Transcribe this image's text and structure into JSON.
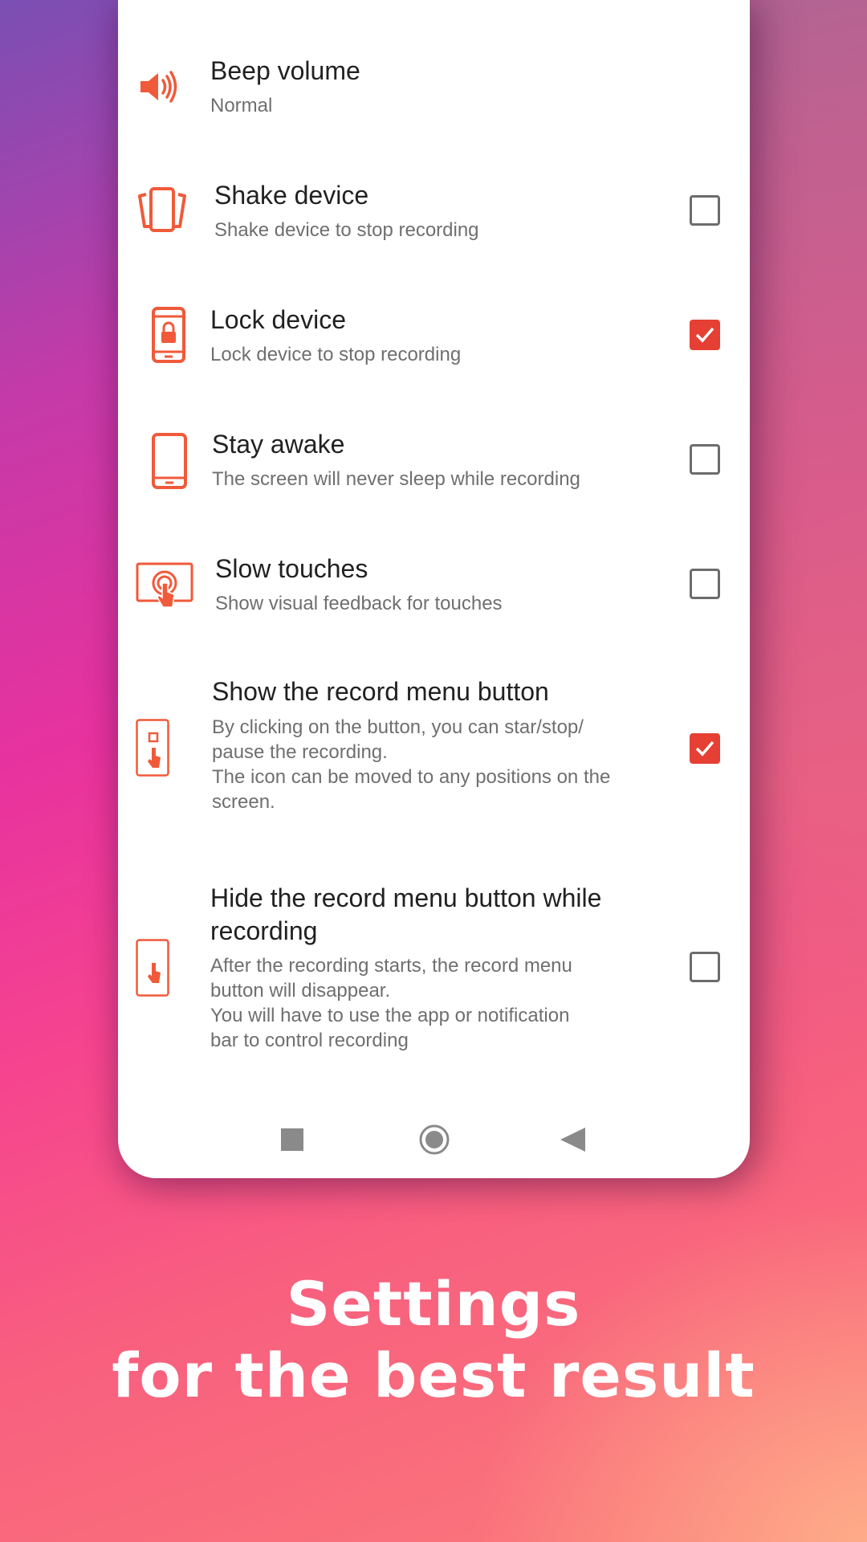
{
  "settings": [
    {
      "title": "Beep volume",
      "subtitle": "Normal",
      "icon": "speaker-icon",
      "has_checkbox": false
    },
    {
      "title": "Shake device",
      "subtitle": "Shake device to stop recording",
      "icon": "shake-device-icon",
      "has_checkbox": true,
      "checked": false
    },
    {
      "title": "Lock device",
      "subtitle": "Lock device to stop recording",
      "icon": "lock-device-icon",
      "has_checkbox": true,
      "checked": true
    },
    {
      "title": "Stay awake",
      "subtitle": "The screen will never sleep while recording",
      "icon": "phone-icon",
      "has_checkbox": true,
      "checked": false
    },
    {
      "title": "Slow touches",
      "subtitle": "Show visual feedback for touches",
      "icon": "touch-feedback-icon",
      "has_checkbox": true,
      "checked": false
    },
    {
      "title": "Show the record menu button",
      "subtitle_lines": [
        "By clicking on the button, you can star/stop/",
        "pause the recording.",
        "The icon can be moved to any positions on the",
        "screen."
      ],
      "icon": "record-menu-button-icon",
      "has_checkbox": true,
      "checked": true
    },
    {
      "title_lines": [
        "Hide the record menu button while",
        "recording"
      ],
      "subtitle_lines": [
        "After the recording starts, the record menu",
        "button will disappear.",
        "You will have to use the app or notification",
        "bar to control recording"
      ],
      "icon": "hide-menu-button-icon",
      "has_checkbox": true,
      "checked": false
    }
  ],
  "caption": {
    "line1": "Settings",
    "line2": "for the best result"
  },
  "colors": {
    "accent": "#e63f33",
    "icon": "#f05a3a"
  },
  "navbar": {
    "recents": "square-icon",
    "home": "circle-icon",
    "back": "triangle-back-icon"
  }
}
